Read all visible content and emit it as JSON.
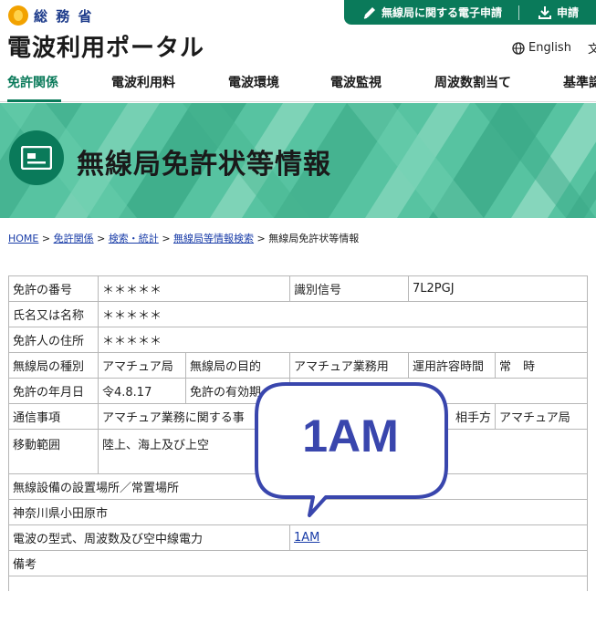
{
  "header": {
    "ministry_name": "総 務 省",
    "portal_title": "電波利用ポータル",
    "apply_items": [
      {
        "label": "無線局に関する電子申請",
        "icon": "pen-icon"
      },
      {
        "label": "申請",
        "icon": "download-icon"
      }
    ],
    "language_label": "English",
    "language_extra": "文"
  },
  "nav": {
    "items": [
      "免許関係",
      "電波利用料",
      "電波環境",
      "電波監視",
      "周波数割当て",
      "基準認証"
    ],
    "active": "免許関係"
  },
  "banner": {
    "title": "無線局免許状等情報",
    "icon": "certificate-icon"
  },
  "breadcrumb": {
    "items": [
      "HOME",
      "免許関係",
      "検索・統計",
      "無線局等情報検索"
    ],
    "separator": ">",
    "current": "無線局免許状等情報"
  },
  "table": {
    "license_number_label": "免許の番号",
    "license_number_value": "＊＊＊＊＊",
    "callsign_label": "識別信号",
    "callsign_value": "7L2PGJ",
    "name_label": "氏名又は名称",
    "name_value": "＊＊＊＊＊",
    "address_label": "免許人の住所",
    "address_value": "＊＊＊＊＊",
    "station_type_label": "無線局の種別",
    "station_type_value": "アマチュア局",
    "purpose_label": "無線局の目的",
    "purpose_value": "アマチュア業務用",
    "operating_hours_label": "運用許容時間",
    "operating_hours_value": "常　時",
    "license_date_label": "免許の年月日",
    "license_date_value": "令4.8.17",
    "validity_label": "免許の有効期",
    "comm_items_label": "通信事項",
    "comm_items_value": "アマチュア業務に関する事",
    "partner_label": "相手方",
    "partner_value": "アマチュア局",
    "movement_area_label": "移動範囲",
    "movement_area_value": "陸上、海上及び上空",
    "install_location_label": "無線設備の設置場所／常置場所",
    "install_location_value": "神奈川県小田原市",
    "radio_spec_label": "電波の型式、周波数及び空中線電力",
    "radio_spec_value": "1AM",
    "remarks_label": "備考",
    "remarks_value": ""
  },
  "callout": {
    "text": "1AM",
    "border_color": "#3946ad"
  },
  "colors": {
    "brand_green": "#0a7a5a",
    "link_blue": "#1a3da8",
    "banner_green": "#4fbf9c"
  }
}
